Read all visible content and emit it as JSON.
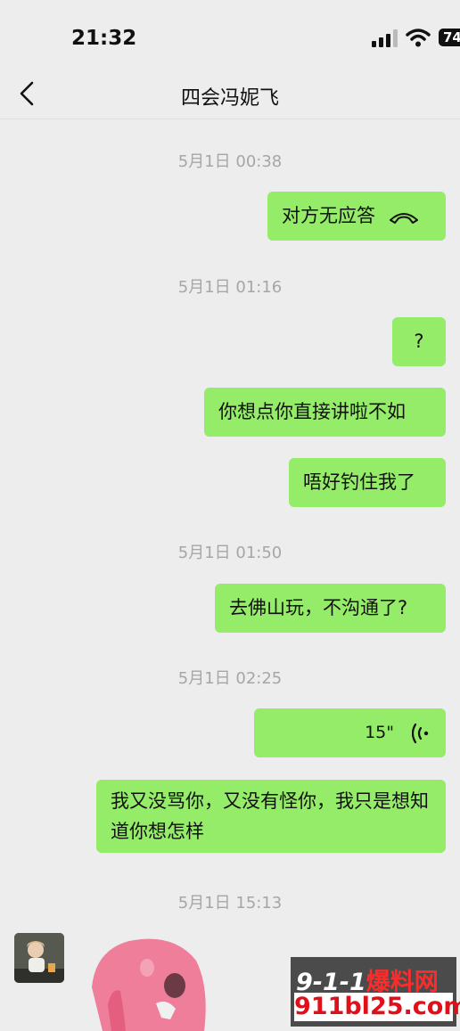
{
  "status": {
    "time": "21:32",
    "battery": "74"
  },
  "header": {
    "title": "四会冯妮飞"
  },
  "timestamps": [
    "5月1日 00:38",
    "5月1日 01:16",
    "5月1日 01:50",
    "5月1日 02:25",
    "5月1日 15:13"
  ],
  "messages": {
    "call": "对方无应答",
    "m1": "?",
    "m2": "你想点你直接讲啦不如",
    "m3": "唔好钓住我了",
    "m4": "去佛山玩，不沟通了?",
    "voice_duration": "15\"",
    "m5": "我又没骂你，又没有怪你，我只是想知道你想怎样"
  },
  "watermark": {
    "top_digits": "9-1-1",
    "top_text": "爆料网",
    "bottom": "911bl25.com"
  },
  "colors": {
    "bubble": "#95ec69",
    "background": "#ededed",
    "timestamp": "#a6a6a6"
  }
}
